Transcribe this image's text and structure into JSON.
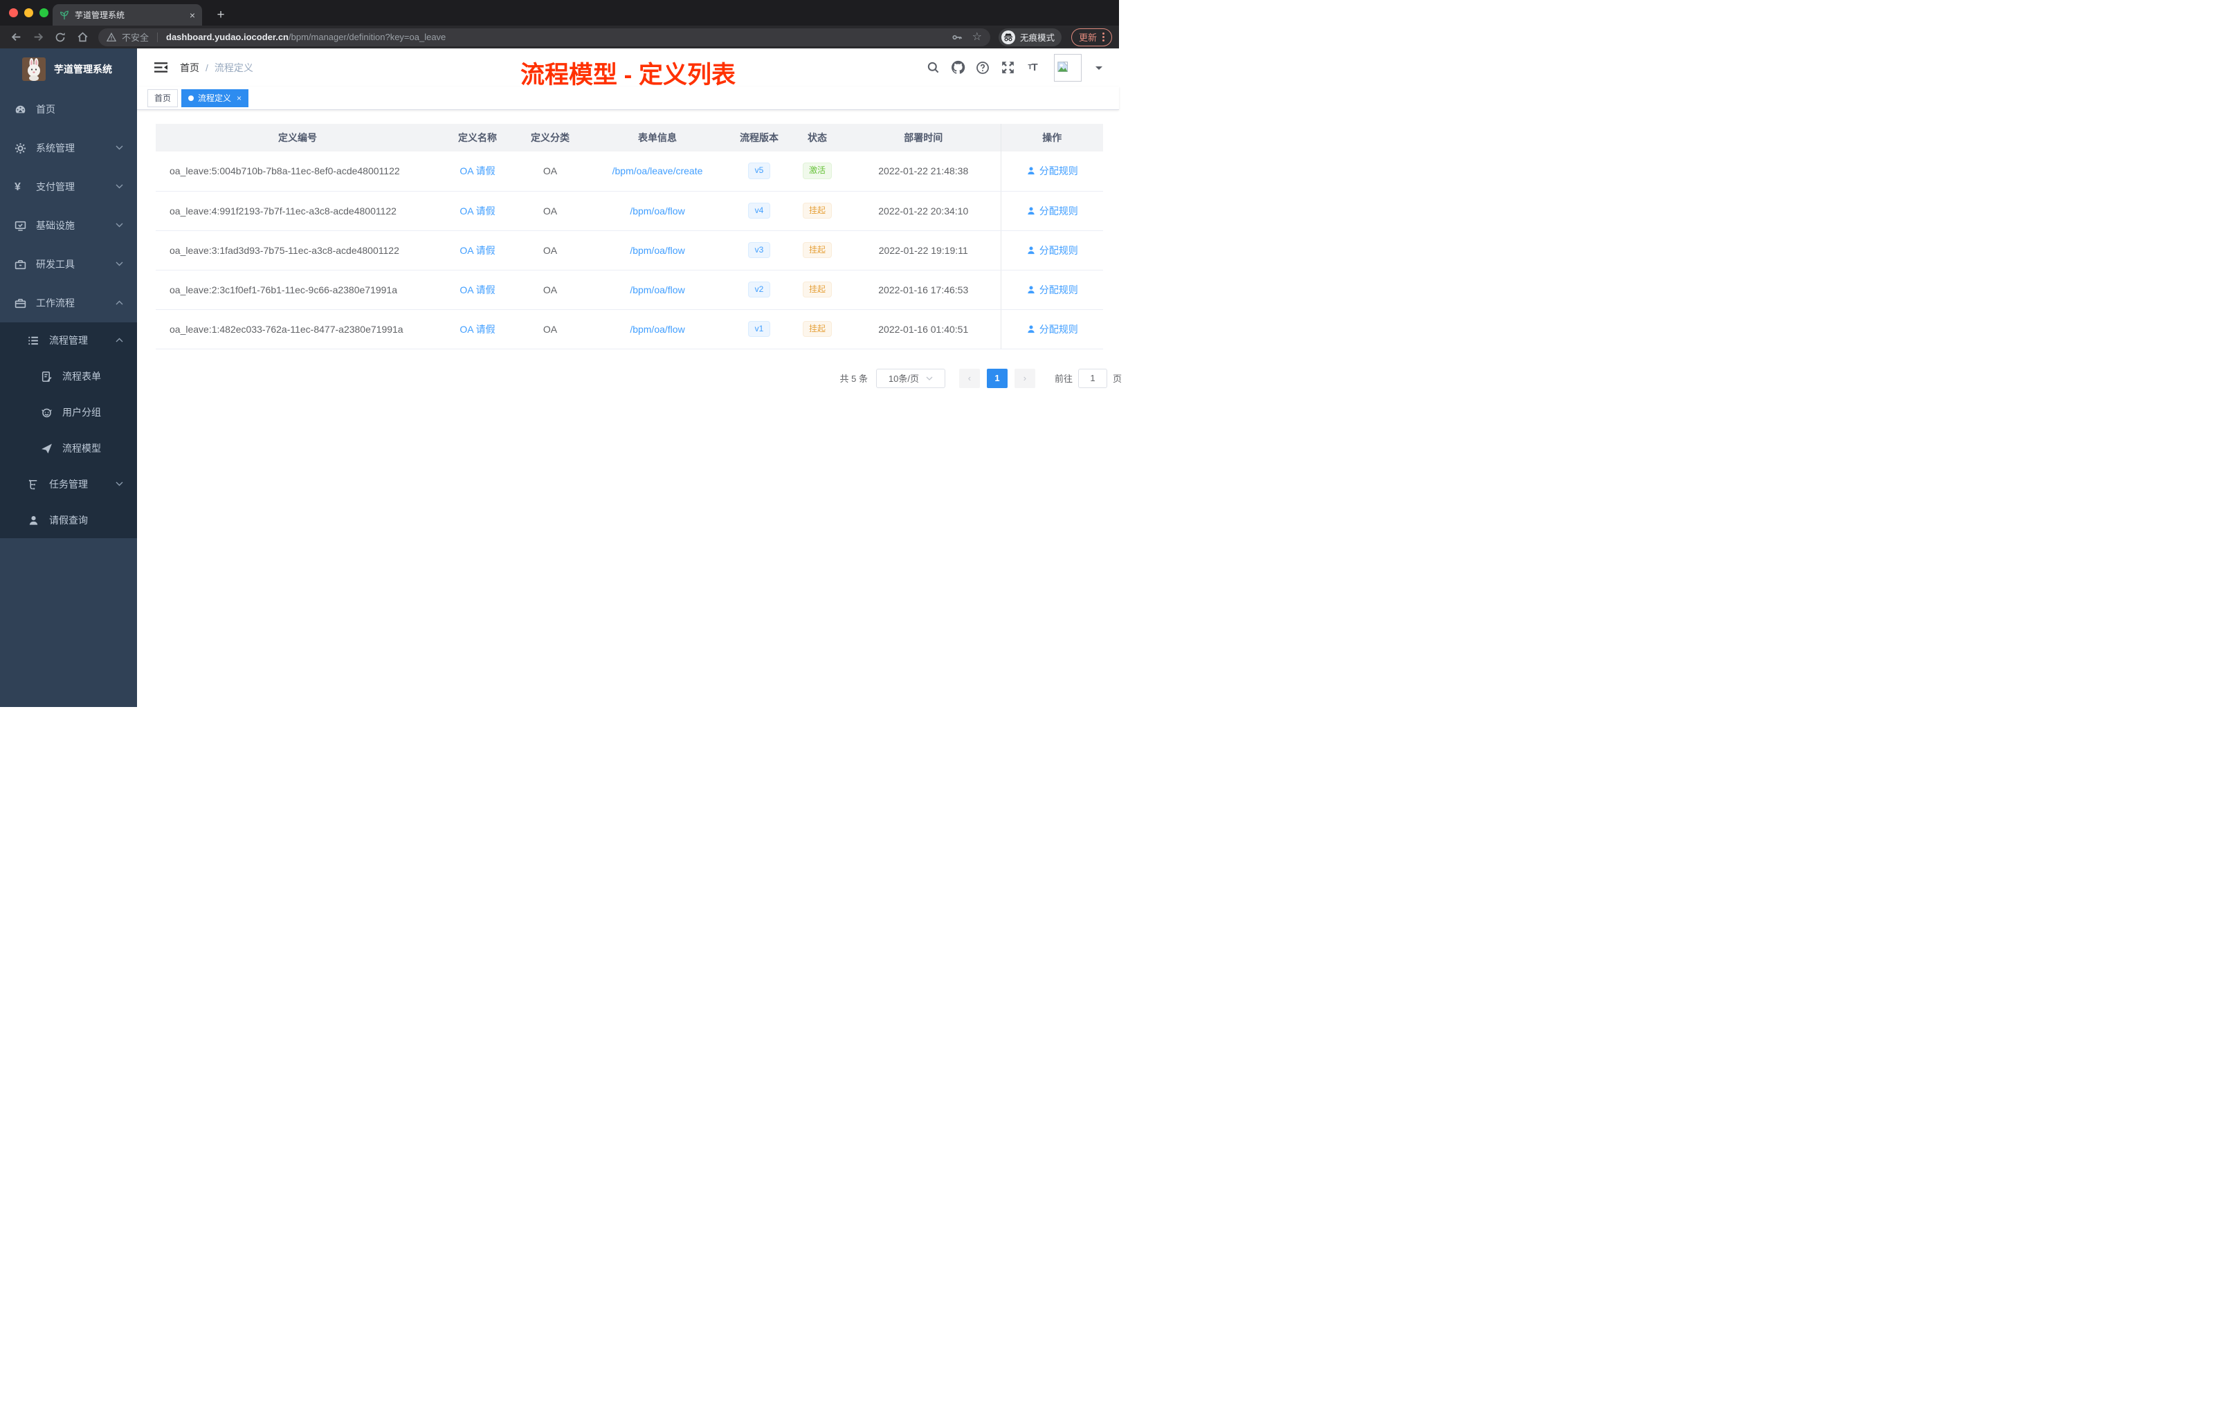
{
  "colors": {
    "accent_text": "#409eff",
    "accent_solid": "#2d8cf0",
    "success": "#67c23a",
    "warning": "#e6a23c",
    "annotation_red": "#ff3100",
    "sidebar_bg": "#304156",
    "submenu_bg": "#1f2d3d"
  },
  "browser": {
    "tab": {
      "title": "芋道管理系统",
      "close": "×",
      "new_tab": "+"
    },
    "toolbar": {
      "security": "不安全",
      "host": "dashboard.yudao.iocoder.cn",
      "path": "/bpm/manager/definition?key=oa_leave",
      "incognito": "无痕模式",
      "update": "更新"
    }
  },
  "sidebar": {
    "title": "芋道管理系统",
    "items": [
      {
        "label": "首页"
      },
      {
        "label": "系统管理"
      },
      {
        "label": "支付管理"
      },
      {
        "label": "基础设施"
      },
      {
        "label": "研发工具"
      },
      {
        "label": "工作流程"
      },
      {
        "label": "流程管理"
      },
      {
        "label": "流程表单"
      },
      {
        "label": "用户分组"
      },
      {
        "label": "流程模型"
      },
      {
        "label": "任务管理"
      },
      {
        "label": "请假查询"
      }
    ]
  },
  "header": {
    "breadcrumb_home": "首页",
    "breadcrumb_sep": "/",
    "breadcrumb_current": "流程定义",
    "annotation": "流程模型 - 定义列表"
  },
  "tags": [
    {
      "label": "首页"
    },
    {
      "label": "流程定义",
      "close": "×"
    }
  ],
  "table": {
    "columns": [
      "定义编号",
      "定义名称",
      "定义分类",
      "表单信息",
      "流程版本",
      "状态",
      "部署时间",
      "操作"
    ],
    "action_label": "分配规则",
    "rows": [
      {
        "id": "oa_leave:5:004b710b-7b8a-11ec-8ef0-acde48001122",
        "name": "OA 请假",
        "category": "OA",
        "form": "/bpm/oa/leave/create",
        "version": "v5",
        "status": "激活",
        "time": "2022-01-22 21:48:38"
      },
      {
        "id": "oa_leave:4:991f2193-7b7f-11ec-a3c8-acde48001122",
        "name": "OA 请假",
        "category": "OA",
        "form": "/bpm/oa/flow",
        "version": "v4",
        "status": "挂起",
        "time": "2022-01-22 20:34:10"
      },
      {
        "id": "oa_leave:3:1fad3d93-7b75-11ec-a3c8-acde48001122",
        "name": "OA 请假",
        "category": "OA",
        "form": "/bpm/oa/flow",
        "version": "v3",
        "status": "挂起",
        "time": "2022-01-22 19:19:11"
      },
      {
        "id": "oa_leave:2:3c1f0ef1-76b1-11ec-9c66-a2380e71991a",
        "name": "OA 请假",
        "category": "OA",
        "form": "/bpm/oa/flow",
        "version": "v2",
        "status": "挂起",
        "time": "2022-01-16 17:46:53"
      },
      {
        "id": "oa_leave:1:482ec033-762a-11ec-8477-a2380e71991a",
        "name": "OA 请假",
        "category": "OA",
        "form": "/bpm/oa/flow",
        "version": "v1",
        "status": "挂起",
        "time": "2022-01-16 01:40:51"
      }
    ]
  },
  "pagination": {
    "total": "共 5 条",
    "page_size": "10条/页",
    "prev": "‹",
    "current": "1",
    "next": "›",
    "goto_label": "前往",
    "goto_value": "1",
    "page_label": "页"
  }
}
